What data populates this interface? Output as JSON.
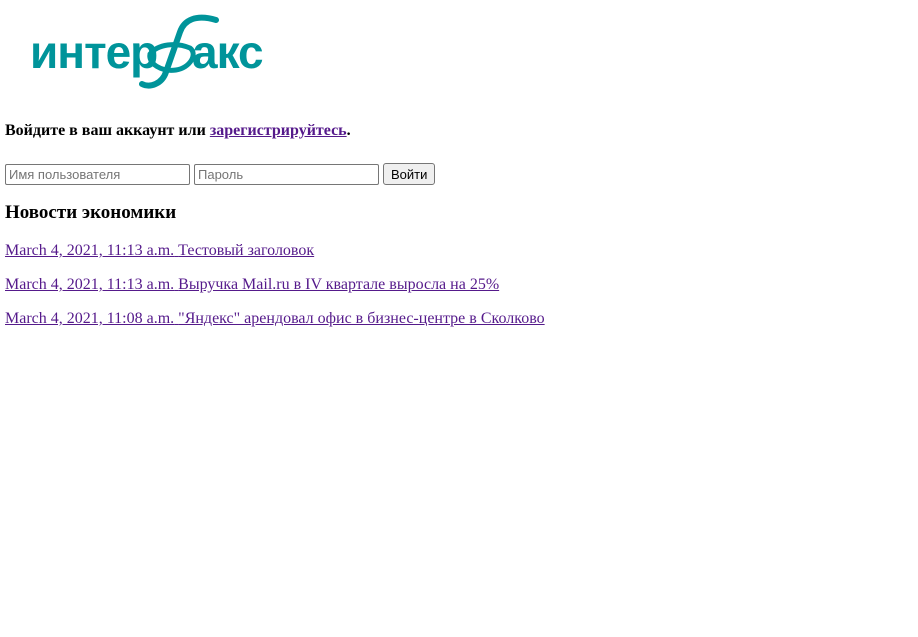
{
  "logo": {
    "text": "интерфакс",
    "color": "#00949a",
    "icon": "interfax-logo"
  },
  "login": {
    "prompt_text": "Войдите в ваш аккаунт или ",
    "register_link": "зарегистрируйтесь",
    "prompt_end": ".",
    "username_placeholder": "Имя пользователя",
    "password_placeholder": "Пароль",
    "submit_label": "Войти"
  },
  "section": {
    "title": "Новости экономики"
  },
  "news": [
    {
      "date": "March 4, 2021, 11:13 a.m.",
      "title": "Тестовый заголовок"
    },
    {
      "date": "March 4, 2021, 11:13 a.m.",
      "title": "Выручка Mail.ru в IV квартале выросла на 25%"
    },
    {
      "date": "March 4, 2021, 11:08 a.m.",
      "title": "\"Яндекс\" арендовал офис в бизнес-центре в Сколково"
    }
  ],
  "colors": {
    "link_visited": "#551a8b",
    "brand": "#00949a"
  }
}
